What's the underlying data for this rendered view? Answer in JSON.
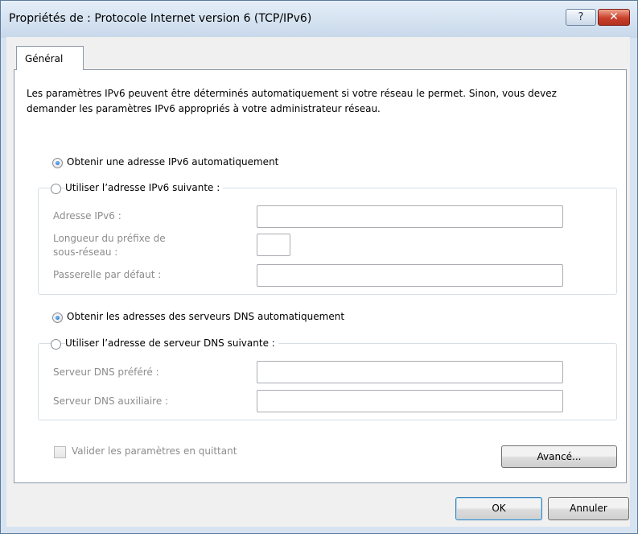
{
  "window": {
    "title": "Propriétés de : Protocole Internet version 6 (TCP/IPv6)",
    "help_label": "?",
    "close_label": "✕"
  },
  "tabs": [
    {
      "label": "Général"
    }
  ],
  "intro": "Les paramètres IPv6 peuvent être déterminés automatiquement si votre réseau le permet. Sinon, vous devez demander les paramètres IPv6 appropriés à votre administrateur réseau.",
  "ip": {
    "auto_label": "Obtenir une adresse IPv6 automatiquement",
    "auto_selected": true,
    "manual_label": "Utiliser l’adresse IPv6 suivante :",
    "address_label": "Adresse IPv6 :",
    "address_value": "",
    "prefix_label_line1": "Longueur du préfixe de",
    "prefix_label_line2": "sous-réseau :",
    "prefix_value": "",
    "gateway_label": "Passerelle par défaut :",
    "gateway_value": ""
  },
  "dns": {
    "auto_label": "Obtenir les adresses des serveurs DNS automatiquement",
    "auto_selected": true,
    "manual_label": "Utiliser l’adresse de serveur DNS suivante :",
    "preferred_label": "Serveur DNS préféré :",
    "preferred_value": "",
    "alternate_label": "Serveur DNS auxiliaire :",
    "alternate_value": ""
  },
  "validate": {
    "label": "Valider les paramètres en quittant",
    "checked": false
  },
  "buttons": {
    "advanced": "Avancé...",
    "ok": "OK",
    "cancel": "Annuler"
  },
  "colors": {
    "window_frame": "#c8d8ea",
    "close_button": "#c8402b",
    "disabled_text": "#8c8c8c",
    "accent_radio": "#1461b8"
  }
}
